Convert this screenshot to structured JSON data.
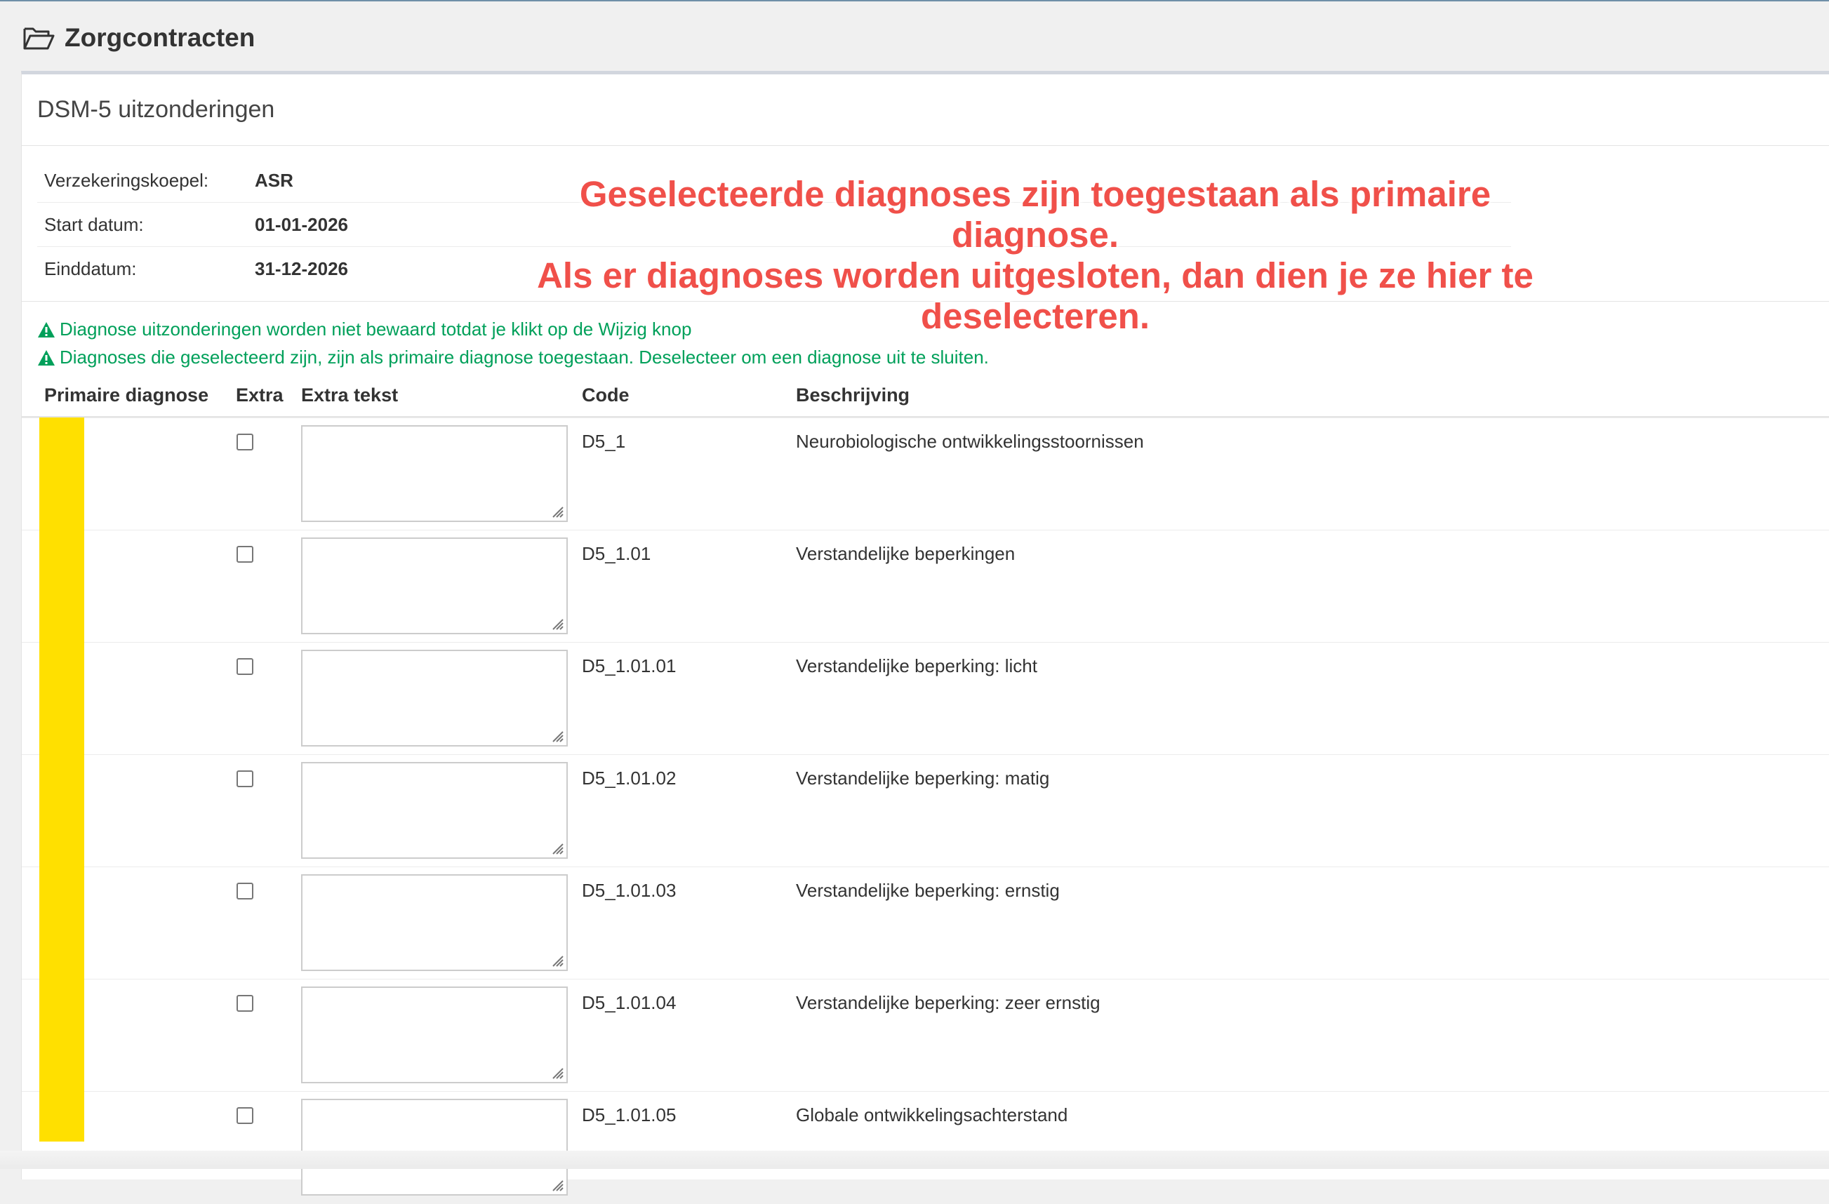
{
  "page": {
    "title": "Zorgcontracten",
    "icon": "folder-open-icon"
  },
  "box": {
    "title": "DSM-5 uitzonderingen"
  },
  "info": [
    {
      "label": "Verzekeringskoepel:",
      "value": "ASR"
    },
    {
      "label": "Start datum:",
      "value": "01-01-2026"
    },
    {
      "label": "Einddatum:",
      "value": "31-12-2026"
    }
  ],
  "warnings": [
    "Diagnose uitzonderingen worden niet bewaard totdat je klikt op de Wijzig knop",
    "Diagnoses die geselecteerd zijn, zijn als primaire diagnose toegestaan. Deselecteer om een diagnose uit te sluiten."
  ],
  "table": {
    "headers": {
      "primary": "Primaire diagnose",
      "extra": "Extra",
      "extra_text": "Extra tekst",
      "code": "Code",
      "description": "Beschrijving"
    },
    "rows": [
      {
        "code": "D5_1",
        "description": "Neurobiologische ontwikkelingsstoornissen",
        "primary": false,
        "extra": false,
        "extra_text": ""
      },
      {
        "code": "D5_1.01",
        "description": "Verstandelijke beperkingen",
        "primary": false,
        "extra": false,
        "extra_text": ""
      },
      {
        "code": "D5_1.01.01",
        "description": "Verstandelijke beperking: licht",
        "primary": false,
        "extra": false,
        "extra_text": ""
      },
      {
        "code": "D5_1.01.02",
        "description": "Verstandelijke beperking: matig",
        "primary": false,
        "extra": false,
        "extra_text": ""
      },
      {
        "code": "D5_1.01.03",
        "description": "Verstandelijke beperking: ernstig",
        "primary": false,
        "extra": false,
        "extra_text": ""
      },
      {
        "code": "D5_1.01.04",
        "description": "Verstandelijke beperking: zeer ernstig",
        "primary": false,
        "extra": false,
        "extra_text": ""
      },
      {
        "code": "D5_1.01.05",
        "description": "Globale ontwikkelingsachterstand",
        "primary": false,
        "extra": false,
        "extra_text": ""
      }
    ]
  },
  "annotation": {
    "lines": [
      "Geselecteerde diagnoses zijn toegestaan als primaire diagnose.",
      "Als er diagnoses worden uitgesloten, dan dien je ze hier te",
      "deselecteren."
    ]
  },
  "colors": {
    "highlight": "#ffe000",
    "annotation": "#f0504a",
    "warning": "#00a05a"
  }
}
